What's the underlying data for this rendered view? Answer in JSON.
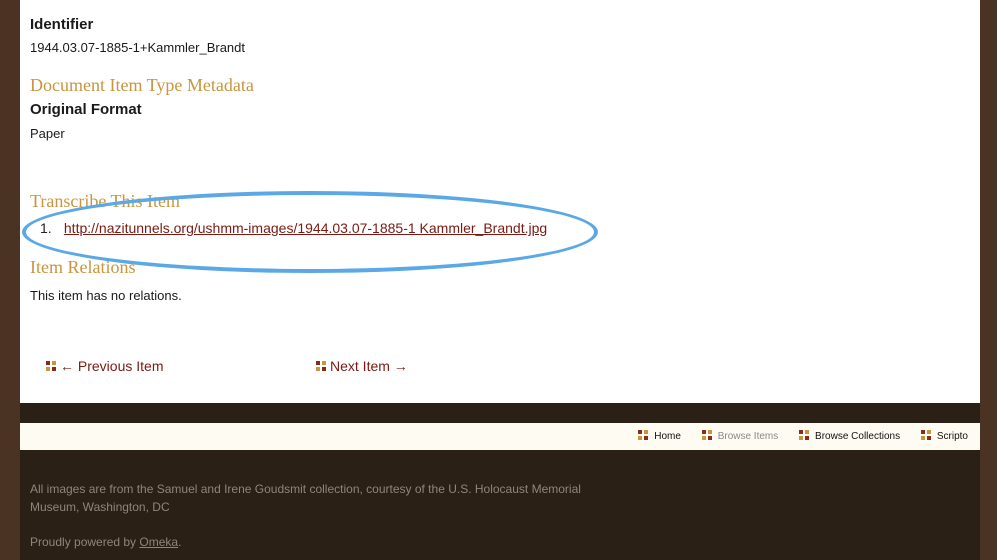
{
  "metadata": {
    "identifier_label": "Identifier",
    "identifier_value": "1944.03.07-1885-1+Kammler_Brandt",
    "item_type_heading": "Document Item Type Metadata",
    "format_label": "Original Format",
    "format_value": "Paper"
  },
  "transcribe": {
    "heading": "Transcribe This Item",
    "items": [
      {
        "num": "1.",
        "link": "http://nazitunnels.org/ushmm-images/1944.03.07-1885-1 Kammler_Brandt.jpg"
      }
    ]
  },
  "relations": {
    "heading": "Item Relations",
    "text": "This item has no relations."
  },
  "pager": {
    "previous": "← Previous Item",
    "next": "Next Item →"
  },
  "nav": {
    "home": "Home",
    "browse_items": "Browse Items",
    "browse_collections": "Browse Collections",
    "scripto": "Scripto"
  },
  "footer": {
    "credit": "All images are from the Samuel and Irene Goudsmit collection, courtesy of the U.S. Holocaust Memorial Museum, Washington, DC",
    "powered_prefix": "Proudly powered by ",
    "powered_link": "Omeka",
    "powered_suffix": "."
  },
  "colors": {
    "accent_heading": "#c9953f",
    "link": "#7a1a12",
    "highlight_oval": "#5aa8e6",
    "background_frame": "#4a3322"
  },
  "icons": {
    "pager_bullet": "four-square-icon",
    "nav_bullet": "four-square-icon"
  }
}
